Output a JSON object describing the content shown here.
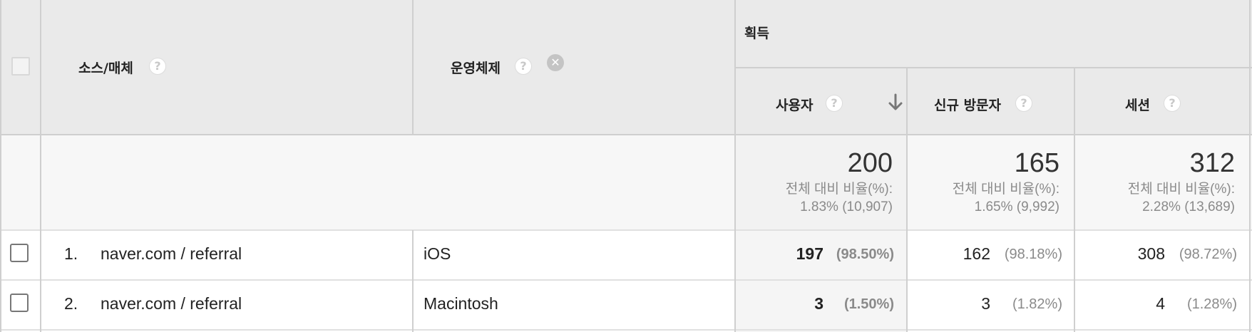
{
  "header": {
    "source_medium": "소스/매체",
    "os": "운영체제",
    "acquisition": "획득",
    "users": "사용자",
    "new_visitors": "신규 방문자",
    "sessions": "세션",
    "help_glyph": "?",
    "remove_glyph": "✕"
  },
  "totals": {
    "users": {
      "value": "200",
      "label": "전체 대비 비율(%):",
      "detail": "1.83% (10,907)"
    },
    "new_visitors": {
      "value": "165",
      "label": "전체 대비 비율(%):",
      "detail": "1.65% (9,992)"
    },
    "sessions": {
      "value": "312",
      "label": "전체 대비 비율(%):",
      "detail": "2.28% (13,689)"
    }
  },
  "rows": [
    {
      "index": "1.",
      "source": "naver.com / referral",
      "os": "iOS",
      "users": "197",
      "users_pct": "(98.50%)",
      "new_visitors": "162",
      "new_visitors_pct": "(98.18%)",
      "sessions": "308",
      "sessions_pct": "(98.72%)"
    },
    {
      "index": "2.",
      "source": "naver.com / referral",
      "os": "Macintosh",
      "users": "3",
      "users_pct": "(1.50%)",
      "new_visitors": "3",
      "new_visitors_pct": "(1.82%)",
      "sessions": "4",
      "sessions_pct": "(1.28%)"
    }
  ],
  "colors": {
    "header_bg": "#eaeaea",
    "totals_bg": "#f7f7f7",
    "sorted_col_bg": "#f5f5f5",
    "border": "#cfcfcf"
  }
}
